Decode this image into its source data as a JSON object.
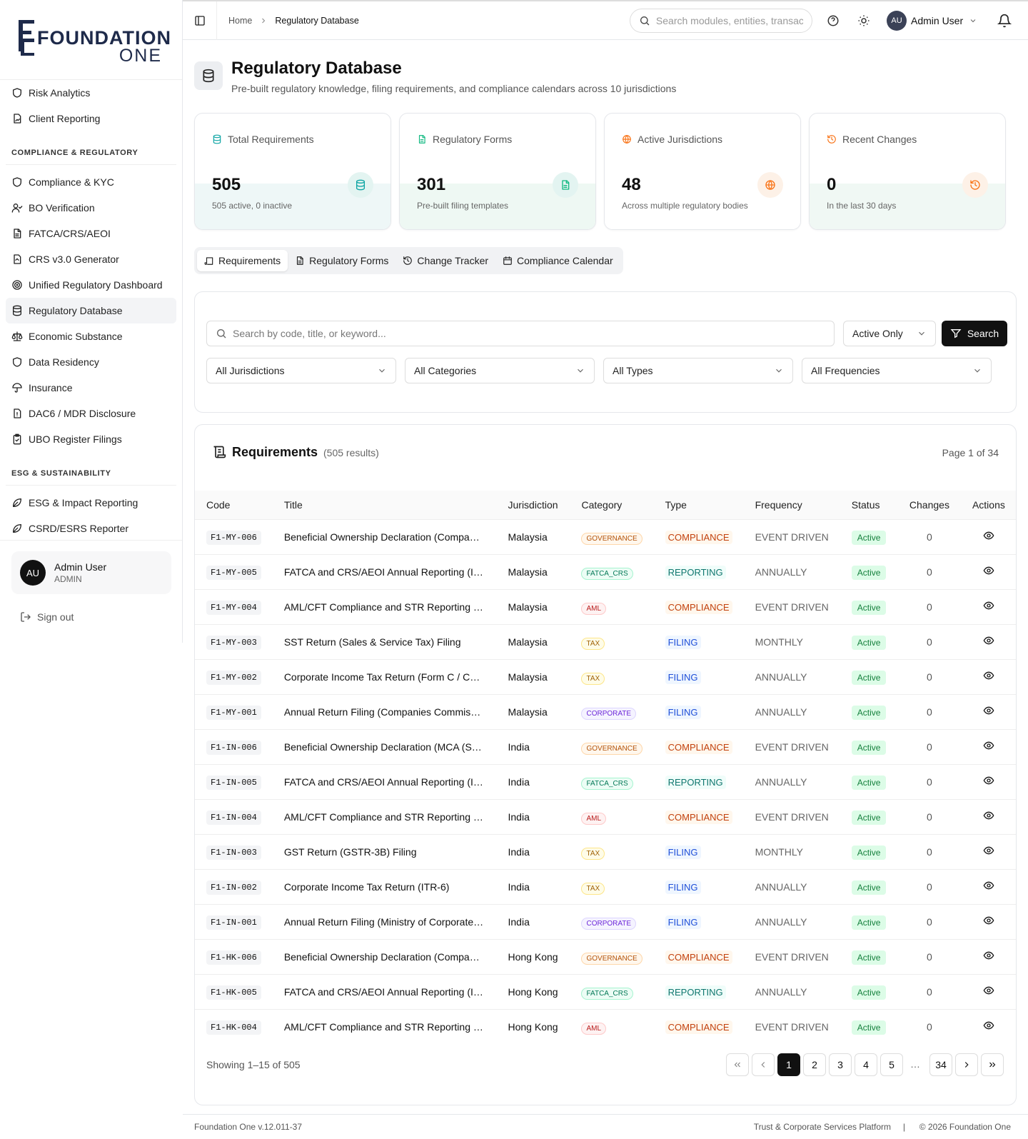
{
  "brand": {
    "line1": "FOUNDATION",
    "line2": "ONE"
  },
  "sidebar": {
    "items_top": [
      {
        "label": "Risk Analytics",
        "icon": "shield-icon"
      },
      {
        "label": "Client Reporting",
        "icon": "report-icon"
      }
    ],
    "section_compliance": "COMPLIANCE & REGULATORY",
    "items_compliance": [
      {
        "label": "Compliance & KYC",
        "icon": "shield-icon"
      },
      {
        "label": "BO Verification",
        "icon": "user-check-icon"
      },
      {
        "label": "FATCA/CRS/AEOI",
        "icon": "document-icon"
      },
      {
        "label": "CRS v3.0 Generator",
        "icon": "generator-icon"
      },
      {
        "label": "Unified Regulatory Dashboard",
        "icon": "dashboard-icon"
      },
      {
        "label": "Regulatory Database",
        "icon": "database-icon",
        "active": true
      },
      {
        "label": "Economic Substance",
        "icon": "scale-icon"
      },
      {
        "label": "Data Residency",
        "icon": "shield-icon"
      },
      {
        "label": "Insurance",
        "icon": "umbrella-icon"
      },
      {
        "label": "DAC6 / MDR Disclosure",
        "icon": "alert-document-icon"
      },
      {
        "label": "UBO Register Filings",
        "icon": "clipboard-icon"
      }
    ],
    "section_esg": "ESG & SUSTAINABILITY",
    "items_esg": [
      {
        "label": "ESG & Impact Reporting",
        "icon": "leaf-icon"
      },
      {
        "label": "CSRD/ESRS Reporter",
        "icon": "leaf-icon"
      }
    ],
    "user": {
      "initials": "AU",
      "name": "Admin User",
      "role": "ADMIN"
    },
    "signout": "Sign out"
  },
  "topbar": {
    "crumb_home": "Home",
    "crumb_current": "Regulatory Database",
    "search_placeholder": "Search modules, entities, transac",
    "user_initials": "AU",
    "user_name": "Admin User"
  },
  "page": {
    "title": "Regulatory Database",
    "subtitle": "Pre-built regulatory knowledge, filing requirements, and compliance calendars across 10 jurisdictions"
  },
  "stats": [
    {
      "label": "Total Requirements",
      "value": "505",
      "sub": "505 active, 0 inactive",
      "icon": "database-icon",
      "color": "#0ea5a4"
    },
    {
      "label": "Regulatory Forms",
      "value": "301",
      "sub": "Pre-built filing templates",
      "icon": "document-icon",
      "color": "#10b981"
    },
    {
      "label": "Active Jurisdictions",
      "value": "48",
      "sub": "Across multiple regulatory bodies",
      "icon": "globe-icon",
      "color": "#f97316"
    },
    {
      "label": "Recent Changes",
      "value": "0",
      "sub": "In the last 30 days",
      "icon": "history-icon",
      "color": "#f97316"
    }
  ],
  "tabs": [
    "Requirements",
    "Regulatory Forms",
    "Change Tracker",
    "Compliance Calendar"
  ],
  "filters": {
    "search_placeholder": "Search by code, title, or keyword...",
    "status": "Active Only",
    "search_button": "Search",
    "jurisdiction": "All Jurisdictions",
    "category": "All Categories",
    "type": "All Types",
    "frequency": "All Frequencies"
  },
  "table": {
    "title": "Requirements",
    "count": "(505 results)",
    "page_info": "Page 1 of 34",
    "columns": [
      "Code",
      "Title",
      "Jurisdiction",
      "Category",
      "Type",
      "Frequency",
      "Status",
      "Changes",
      "Actions"
    ],
    "rows": [
      [
        "F1-MY-006",
        "Beneficial Ownership Declaration (Compa…",
        "Malaysia",
        "GOVERNANCE",
        "COMPLIANCE",
        "EVENT DRIVEN",
        "Active",
        "0"
      ],
      [
        "F1-MY-005",
        "FATCA and CRS/AEOI Annual Reporting (I…",
        "Malaysia",
        "FATCA_CRS",
        "REPORTING",
        "ANNUALLY",
        "Active",
        "0"
      ],
      [
        "F1-MY-004",
        "AML/CFT Compliance and STR Reporting …",
        "Malaysia",
        "AML",
        "COMPLIANCE",
        "EVENT DRIVEN",
        "Active",
        "0"
      ],
      [
        "F1-MY-003",
        "SST Return (Sales & Service Tax) Filing",
        "Malaysia",
        "TAX",
        "FILING",
        "MONTHLY",
        "Active",
        "0"
      ],
      [
        "F1-MY-002",
        "Corporate Income Tax Return (Form C / C…",
        "Malaysia",
        "TAX",
        "FILING",
        "ANNUALLY",
        "Active",
        "0"
      ],
      [
        "F1-MY-001",
        "Annual Return Filing (Companies Commis…",
        "Malaysia",
        "CORPORATE",
        "FILING",
        "ANNUALLY",
        "Active",
        "0"
      ],
      [
        "F1-IN-006",
        "Beneficial Ownership Declaration (MCA (S…",
        "India",
        "GOVERNANCE",
        "COMPLIANCE",
        "EVENT DRIVEN",
        "Active",
        "0"
      ],
      [
        "F1-IN-005",
        "FATCA and CRS/AEOI Annual Reporting (I…",
        "India",
        "FATCA_CRS",
        "REPORTING",
        "ANNUALLY",
        "Active",
        "0"
      ],
      [
        "F1-IN-004",
        "AML/CFT Compliance and STR Reporting …",
        "India",
        "AML",
        "COMPLIANCE",
        "EVENT DRIVEN",
        "Active",
        "0"
      ],
      [
        "F1-IN-003",
        "GST Return (GSTR-3B) Filing",
        "India",
        "TAX",
        "FILING",
        "MONTHLY",
        "Active",
        "0"
      ],
      [
        "F1-IN-002",
        "Corporate Income Tax Return (ITR-6)",
        "India",
        "TAX",
        "FILING",
        "ANNUALLY",
        "Active",
        "0"
      ],
      [
        "F1-IN-001",
        "Annual Return Filing (Ministry of Corporate…",
        "India",
        "CORPORATE",
        "FILING",
        "ANNUALLY",
        "Active",
        "0"
      ],
      [
        "F1-HK-006",
        "Beneficial Ownership Declaration (Compa…",
        "Hong Kong",
        "GOVERNANCE",
        "COMPLIANCE",
        "EVENT DRIVEN",
        "Active",
        "0"
      ],
      [
        "F1-HK-005",
        "FATCA and CRS/AEOI Annual Reporting (I…",
        "Hong Kong",
        "FATCA_CRS",
        "REPORTING",
        "ANNUALLY",
        "Active",
        "0"
      ],
      [
        "F1-HK-004",
        "AML/CFT Compliance and STR Reporting …",
        "Hong Kong",
        "AML",
        "COMPLIANCE",
        "EVENT DRIVEN",
        "Active",
        "0"
      ]
    ],
    "showing": "Showing 1–15 of 505",
    "pages": [
      "1",
      "2",
      "3",
      "4",
      "5"
    ],
    "ellipsis": "…",
    "last_page": "34"
  },
  "footer": {
    "version": "Foundation One v.12.011-37",
    "platform": "Trust & Corporate Services Platform",
    "sep": "|",
    "copyright": "© 2026 Foundation One"
  }
}
